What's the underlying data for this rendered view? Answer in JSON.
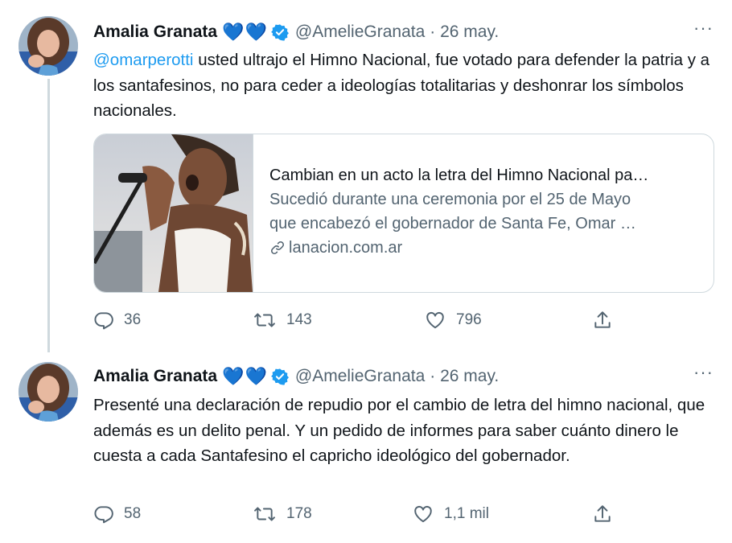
{
  "tweets": [
    {
      "name": "Amalia Granata",
      "hearts": [
        "💙",
        "💙"
      ],
      "handle": "@AmelieGranata",
      "date": "· 26 may.",
      "more": "···",
      "mention": "@omarperotti",
      "text": " usted ultrajo el Himno Nacional, fue votado para defender la patria y a los santafesinos, no para ceder a ideologías totalitarias y deshonrar los símbolos nacionales.",
      "card": {
        "title": "Cambian en un acto la letra del Himno Nacional pa…",
        "description_line1": "Sucedió durante una ceremonia por el 25 de Mayo",
        "description_line2": "que encabezó el gobernador de Santa Fe, Omar …",
        "domain": "lanacion.com.ar"
      },
      "replies": "36",
      "retweets": "143",
      "likes": "796"
    },
    {
      "name": "Amalia Granata",
      "hearts": [
        "💙",
        "💙"
      ],
      "handle": "@AmelieGranata",
      "date": "· 26 may.",
      "more": "···",
      "text": "Presenté una declaración de repudio por el cambio de letra del himno nacional, que además es un delito penal. Y un pedido de informes para saber cuánto dinero le cuesta a cada Santafesino el capricho ideológico del gobernador.",
      "replies": "58",
      "retweets": "178",
      "likes": "1,1 mil"
    }
  ],
  "colors": {
    "link": "#1d9bf0",
    "secondary": "#536471",
    "verified": "#1d9bf0",
    "border": "#cfd9de"
  },
  "icons": [
    "verified-badge-icon",
    "reply-icon",
    "retweet-icon",
    "like-icon",
    "share-icon",
    "link-icon",
    "more-icon"
  ]
}
